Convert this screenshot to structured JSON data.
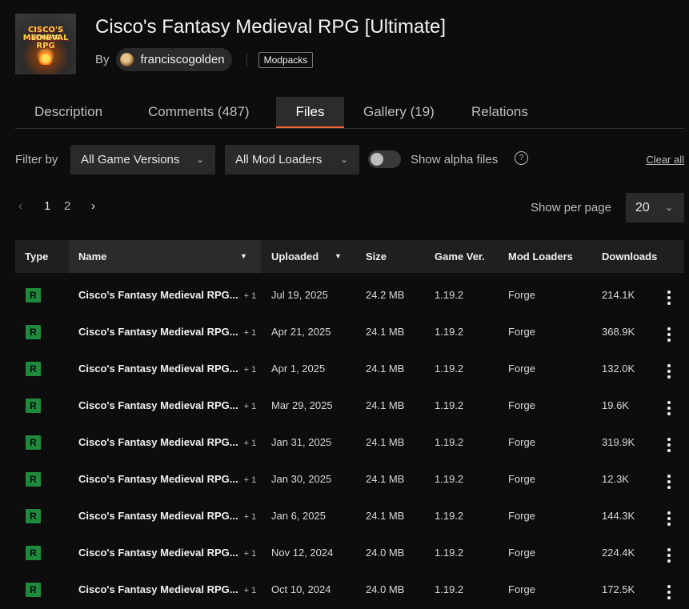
{
  "project": {
    "logo_text": "CISCO'S MEDIEVAL RPG",
    "logo_subtext": "ULTIMATE",
    "title": "Cisco's Fantasy Medieval RPG [Ultimate]",
    "by_label": "By",
    "author": "franciscogolden",
    "tag": "Modpacks"
  },
  "tabs": [
    {
      "label": "Description",
      "active": false
    },
    {
      "label": "Comments (487)",
      "active": false
    },
    {
      "label": "Files",
      "active": true
    },
    {
      "label": "Gallery (19)",
      "active": false
    },
    {
      "label": "Relations",
      "active": false
    }
  ],
  "filters": {
    "label": "Filter by",
    "game_versions": "All Game Versions",
    "mod_loaders": "All Mod Loaders",
    "alpha_label": "Show alpha files",
    "alpha_enabled": false,
    "help": "?",
    "clear_all": "Clear all"
  },
  "pagination": {
    "prev": "‹",
    "pages": [
      "1",
      "2"
    ],
    "current": "1",
    "next": "›",
    "per_page_label": "Show per page",
    "per_page_value": "20"
  },
  "table": {
    "headers": {
      "type": "Type",
      "name": "Name",
      "uploaded": "Uploaded",
      "size": "Size",
      "game_ver": "Game Ver.",
      "mod_loaders": "Mod Loaders",
      "downloads": "Downloads"
    },
    "sort_glyph": "▼",
    "rows": [
      {
        "type": "R",
        "name": "Cisco's Fantasy Medieval RPG...",
        "plus": "+ 1",
        "uploaded": "Jul 19, 2025",
        "size": "24.2 MB",
        "game_ver": "1.19.2",
        "loader": "Forge",
        "downloads": "214.1K"
      },
      {
        "type": "R",
        "name": "Cisco's Fantasy Medieval RPG...",
        "plus": "+ 1",
        "uploaded": "Apr 21, 2025",
        "size": "24.1 MB",
        "game_ver": "1.19.2",
        "loader": "Forge",
        "downloads": "368.9K"
      },
      {
        "type": "R",
        "name": "Cisco's Fantasy Medieval RPG...",
        "plus": "+ 1",
        "uploaded": "Apr 1, 2025",
        "size": "24.1 MB",
        "game_ver": "1.19.2",
        "loader": "Forge",
        "downloads": "132.0K"
      },
      {
        "type": "R",
        "name": "Cisco's Fantasy Medieval RPG...",
        "plus": "+ 1",
        "uploaded": "Mar 29, 2025",
        "size": "24.1 MB",
        "game_ver": "1.19.2",
        "loader": "Forge",
        "downloads": "19.6K"
      },
      {
        "type": "R",
        "name": "Cisco's Fantasy Medieval RPG...",
        "plus": "+ 1",
        "uploaded": "Jan 31, 2025",
        "size": "24.1 MB",
        "game_ver": "1.19.2",
        "loader": "Forge",
        "downloads": "319.9K"
      },
      {
        "type": "R",
        "name": "Cisco's Fantasy Medieval RPG...",
        "plus": "+ 1",
        "uploaded": "Jan 30, 2025",
        "size": "24.1 MB",
        "game_ver": "1.19.2",
        "loader": "Forge",
        "downloads": "12.3K"
      },
      {
        "type": "R",
        "name": "Cisco's Fantasy Medieval RPG...",
        "plus": "+ 1",
        "uploaded": "Jan 6, 2025",
        "size": "24.1 MB",
        "game_ver": "1.19.2",
        "loader": "Forge",
        "downloads": "144.3K"
      },
      {
        "type": "R",
        "name": "Cisco's Fantasy Medieval RPG...",
        "plus": "+ 1",
        "uploaded": "Nov 12, 2024",
        "size": "24.0 MB",
        "game_ver": "1.19.2",
        "loader": "Forge",
        "downloads": "224.4K"
      },
      {
        "type": "R",
        "name": "Cisco's Fantasy Medieval RPG...",
        "plus": "+ 1",
        "uploaded": "Oct 10, 2024",
        "size": "24.0 MB",
        "game_ver": "1.19.2",
        "loader": "Forge",
        "downloads": "172.5K"
      }
    ]
  },
  "colors": {
    "accent": "#f16436",
    "release_badge": "#1f8a3b",
    "background": "#0d0d0d"
  }
}
